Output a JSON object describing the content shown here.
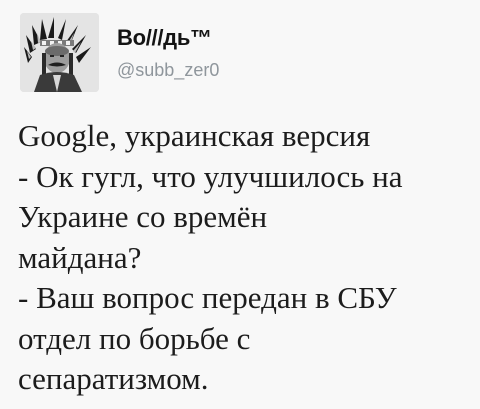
{
  "tweet": {
    "author": {
      "display_name": "Во///дь™",
      "handle": "@subb_zer0",
      "avatar_icon": "user-avatar-portrait"
    },
    "text_lines": [
      "Google, украинская версия",
      "- Ок гугл, что улучшилось на",
      "Украине со времён",
      "майдана?",
      "- Ваш вопрос передан в СБУ",
      "отдел по борьбе с",
      "сепаратизмом."
    ]
  }
}
